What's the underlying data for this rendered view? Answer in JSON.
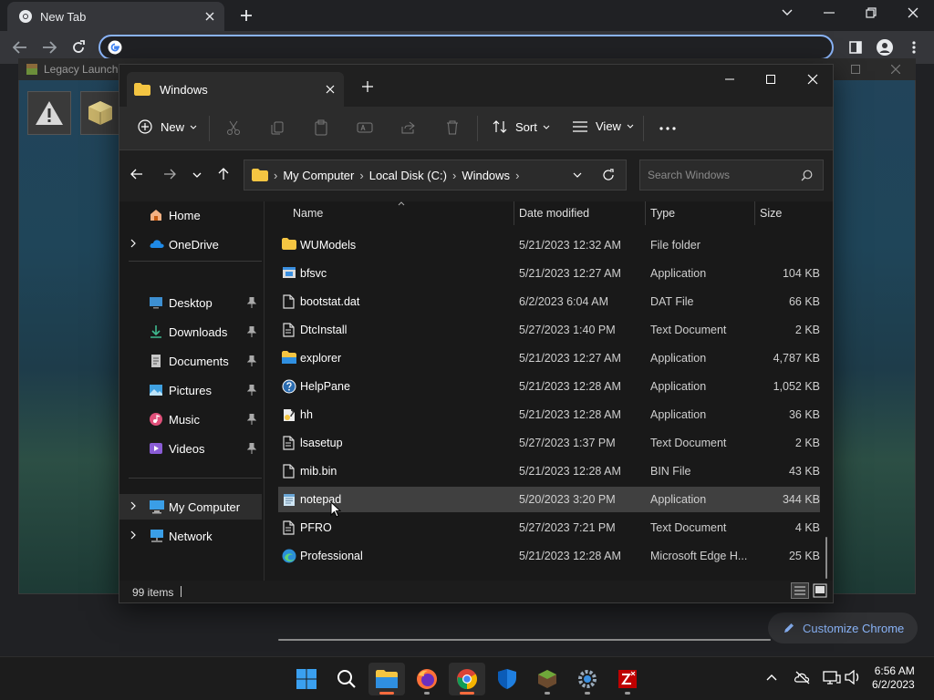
{
  "chrome": {
    "tab_title": "New Tab",
    "customize_label": "Customize Chrome"
  },
  "launcher": {
    "title": "Legacy Launch"
  },
  "explorer": {
    "tab_title": "Windows",
    "cmd": {
      "new": "New",
      "sort": "Sort",
      "view": "View"
    },
    "breadcrumb": [
      "My Computer",
      "Local Disk (C:)",
      "Windows"
    ],
    "search_placeholder": "Search Windows",
    "nav": {
      "home": "Home",
      "onedrive": "OneDrive",
      "desktop": "Desktop",
      "downloads": "Downloads",
      "documents": "Documents",
      "pictures": "Pictures",
      "music": "Music",
      "videos": "Videos",
      "my_computer": "My Computer",
      "network": "Network"
    },
    "columns": {
      "name": "Name",
      "date": "Date modified",
      "type": "Type",
      "size": "Size"
    },
    "files": [
      {
        "name": "WUModels",
        "date": "5/21/2023 12:32 AM",
        "type": "File folder",
        "size": "",
        "icon": "folder-icon"
      },
      {
        "name": "bfsvc",
        "date": "5/21/2023 12:27 AM",
        "type": "Application",
        "size": "104 KB",
        "icon": "app-icon"
      },
      {
        "name": "bootstat.dat",
        "date": "6/2/2023 6:04 AM",
        "type": "DAT File",
        "size": "66 KB",
        "icon": "file-icon"
      },
      {
        "name": "DtcInstall",
        "date": "5/27/2023 1:40 PM",
        "type": "Text Document",
        "size": "2 KB",
        "icon": "text-file-icon"
      },
      {
        "name": "explorer",
        "date": "5/21/2023 12:27 AM",
        "type": "Application",
        "size": "4,787 KB",
        "icon": "explorer-icon"
      },
      {
        "name": "HelpPane",
        "date": "5/21/2023 12:28 AM",
        "type": "Application",
        "size": "1,052 KB",
        "icon": "help-icon"
      },
      {
        "name": "hh",
        "date": "5/21/2023 12:28 AM",
        "type": "Application",
        "size": "36 KB",
        "icon": "hh-icon"
      },
      {
        "name": "lsasetup",
        "date": "5/27/2023 1:37 PM",
        "type": "Text Document",
        "size": "2 KB",
        "icon": "text-file-icon"
      },
      {
        "name": "mib.bin",
        "date": "5/21/2023 12:28 AM",
        "type": "BIN File",
        "size": "43 KB",
        "icon": "file-icon"
      },
      {
        "name": "notepad",
        "date": "5/20/2023 3:20 PM",
        "type": "Application",
        "size": "344 KB",
        "icon": "notepad-icon"
      },
      {
        "name": "PFRO",
        "date": "5/27/2023 7:21 PM",
        "type": "Text Document",
        "size": "4 KB",
        "icon": "text-file-icon"
      },
      {
        "name": "Professional",
        "date": "5/21/2023 12:28 AM",
        "type": "Microsoft Edge H...",
        "size": "25 KB",
        "icon": "edge-icon"
      }
    ],
    "selected_index": 9,
    "item_count": "99 items"
  },
  "clock": {
    "time": "6:56 AM",
    "date": "6/2/2023"
  },
  "colors": {
    "accent": "#8ab4f8",
    "folder": "#f4c542",
    "selection": "#404040"
  }
}
